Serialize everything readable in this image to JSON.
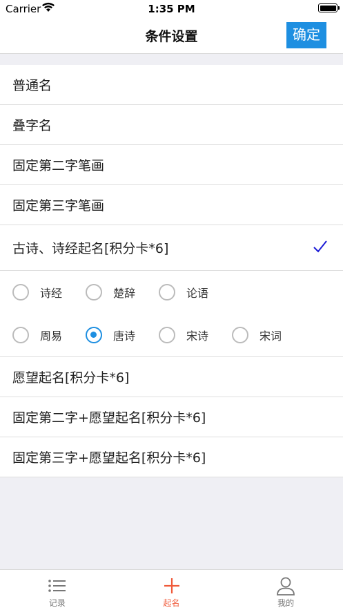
{
  "status_bar": {
    "carrier": "Carrier",
    "time": "1:35 PM"
  },
  "nav": {
    "title": "条件设置",
    "confirm_label": "确定"
  },
  "options": [
    {
      "label": "普通名",
      "checked": false
    },
    {
      "label": "叠字名",
      "checked": false
    },
    {
      "label": "固定第二字笔画",
      "checked": false
    },
    {
      "label": "固定第三字笔画",
      "checked": false
    },
    {
      "label": "古诗、诗经起名[积分卡*6]",
      "checked": true
    }
  ],
  "poetry_sources": {
    "row1": [
      {
        "label": "诗经",
        "selected": false
      },
      {
        "label": "楚辞",
        "selected": false
      },
      {
        "label": "论语",
        "selected": false
      }
    ],
    "row2": [
      {
        "label": "周易",
        "selected": false
      },
      {
        "label": "唐诗",
        "selected": true
      },
      {
        "label": "宋诗",
        "selected": false
      },
      {
        "label": "宋词",
        "selected": false
      }
    ]
  },
  "options_more": [
    {
      "label": "愿望起名[积分卡*6]"
    },
    {
      "label": "固定第二字+愿望起名[积分卡*6]"
    },
    {
      "label": "固定第三字+愿望起名[积分卡*6]"
    }
  ],
  "tab_bar": [
    {
      "label": "记录",
      "icon": "list-icon",
      "active": false
    },
    {
      "label": "起名",
      "icon": "plus-icon",
      "active": true
    },
    {
      "label": "我的",
      "icon": "person-icon",
      "active": false
    }
  ],
  "colors": {
    "accent": "#1e8fe1",
    "tab_active": "#f05a3a",
    "check": "#1a1ad6"
  }
}
